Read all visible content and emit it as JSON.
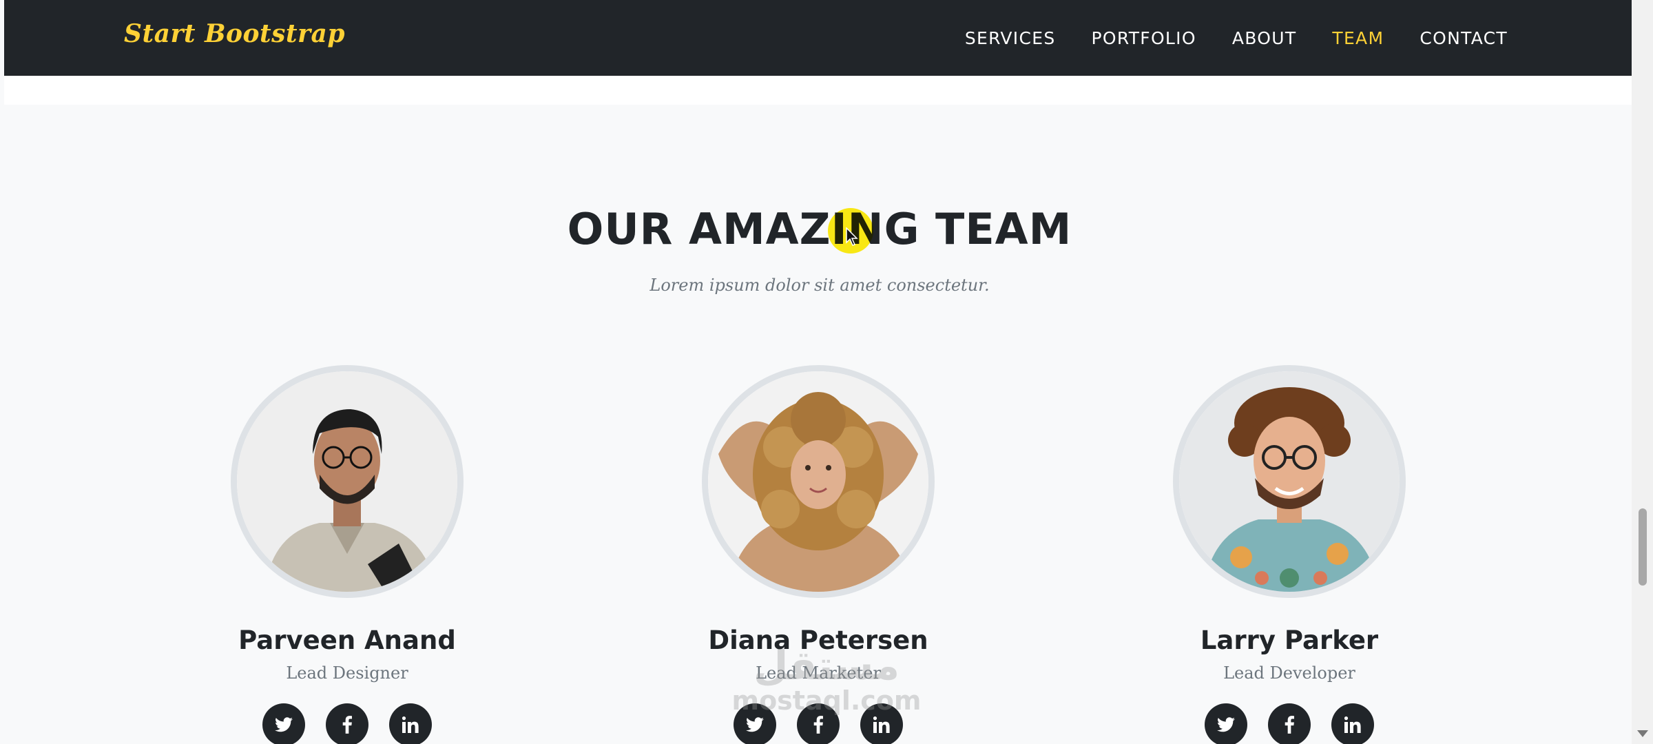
{
  "navbar": {
    "brand": "Start Bootstrap",
    "links": [
      {
        "label": "SERVICES",
        "active": false
      },
      {
        "label": "PORTFOLIO",
        "active": false
      },
      {
        "label": "ABOUT",
        "active": false
      },
      {
        "label": "TEAM",
        "active": true
      },
      {
        "label": "CONTACT",
        "active": false
      }
    ]
  },
  "team": {
    "heading": "OUR AMAZING TEAM",
    "subheading": "Lorem ipsum dolor sit amet consectetur.",
    "members": [
      {
        "name": "Parveen Anand",
        "role": "Lead Designer"
      },
      {
        "name": "Diana Petersen",
        "role": "Lead Marketer"
      },
      {
        "name": "Larry Parker",
        "role": "Lead Developer"
      }
    ],
    "social_icons": [
      "twitter-icon",
      "facebook-icon",
      "linkedin-icon"
    ]
  },
  "watermark": {
    "arabic": "مستقل",
    "url": "mostaql.com"
  },
  "colors": {
    "navbar_bg": "#212529",
    "accent": "#fed136",
    "page_bg": "#f8f9fa",
    "heading": "#212529",
    "muted": "#6c757d"
  }
}
